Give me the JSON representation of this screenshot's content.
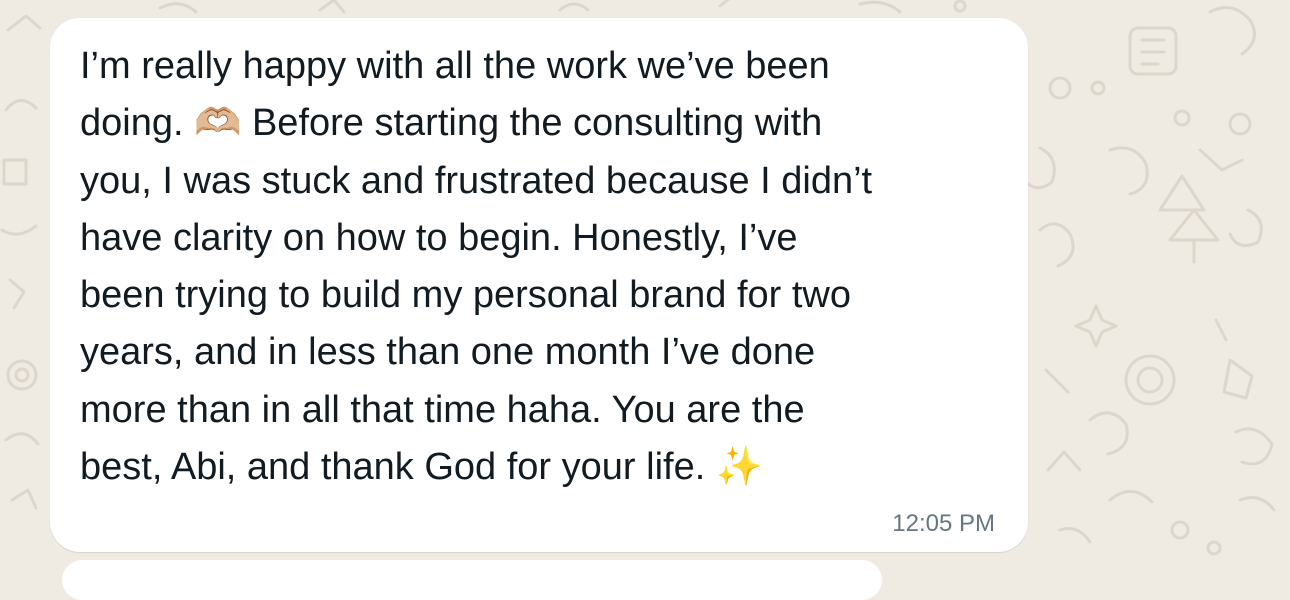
{
  "chat": {
    "message": {
      "text": "I’m really happy with all the work we’ve been\ndoing. 🫶🏼 Before starting the consulting with\nyou, I was stuck and frustrated because I didn’t\nhave clarity on how to begin. Honestly, I’ve\nbeen trying to build my personal brand for two\nyears, and in less than one month I’ve done\nmore than in all that time haha. You are the\nbest, Abi, and thank God for your life. ✨",
      "time": "12:05 PM"
    }
  },
  "colors": {
    "wallpaper": "#efeae2",
    "bubble": "#ffffff",
    "text": "#111b21",
    "timestamp": "#667781"
  }
}
